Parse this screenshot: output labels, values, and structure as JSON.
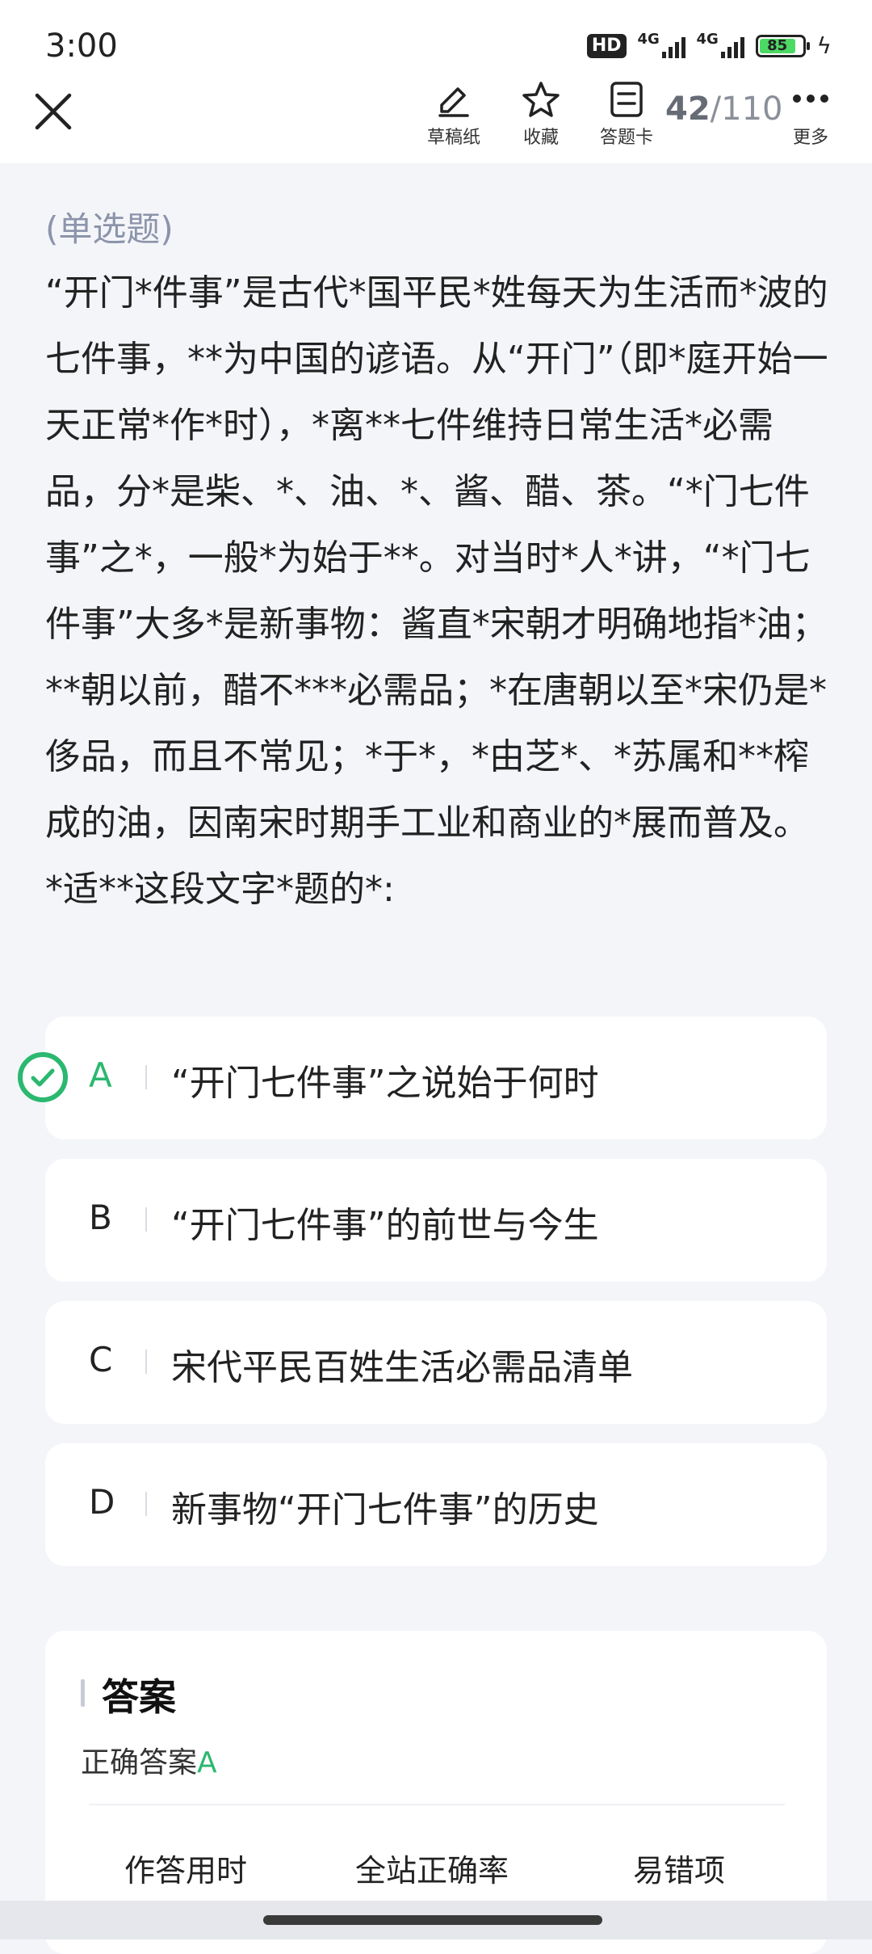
{
  "status_bar": {
    "time": "3:00",
    "hd_label": "HD",
    "network_1": "4G",
    "network_2": "4G",
    "battery": "85",
    "charging_icon": "bolt-icon"
  },
  "toolbar": {
    "draft_label": "草稿纸",
    "favorite_label": "收藏",
    "answer_card_label": "答题卡",
    "counter_current": "42",
    "counter_total": "/110",
    "more_label": "更多"
  },
  "question": {
    "type": "(单选题)",
    "text": "“开门*件事”是古代*国平民*姓每天为生活而*波的七件事，**为中国的谚语。从“开门”（即*庭开始一天正常*作*时），*离**七件维持日常生活*必需品，分*是柴、*、油、*、酱、醋、茶。“*门七件事”之*，一般*为始于**。对当时*人*讲，“*门七件事”大多*是新事物：酱直*宋朝才明确地指*油；**朝以前，醋不***必需品；*在唐朝以至*宋仍是*侈品，而且不常见；*于*，*由芝*、*苏属和**榨成的油，因南宋时期手工业和商业的*展而普及。\n*适**这段文字*题的*:"
  },
  "options": [
    {
      "letter": "A",
      "text": "“开门七件事”之说始于何时",
      "correct": true
    },
    {
      "letter": "B",
      "text": "“开门七件事”的前世与今生",
      "correct": false
    },
    {
      "letter": "C",
      "text": "宋代平民百姓生活必需品清单",
      "correct": false
    },
    {
      "letter": "D",
      "text": "新事物“开门七件事”的历史",
      "correct": false
    }
  ],
  "answer": {
    "title": "答案",
    "label": "正确答案",
    "value": "A",
    "stats": [
      "作答用时",
      "全站正确率",
      "易错项"
    ]
  },
  "colors": {
    "correct": "#2bb86f",
    "muted": "#8b94aa",
    "background": "#f4f5f9"
  }
}
